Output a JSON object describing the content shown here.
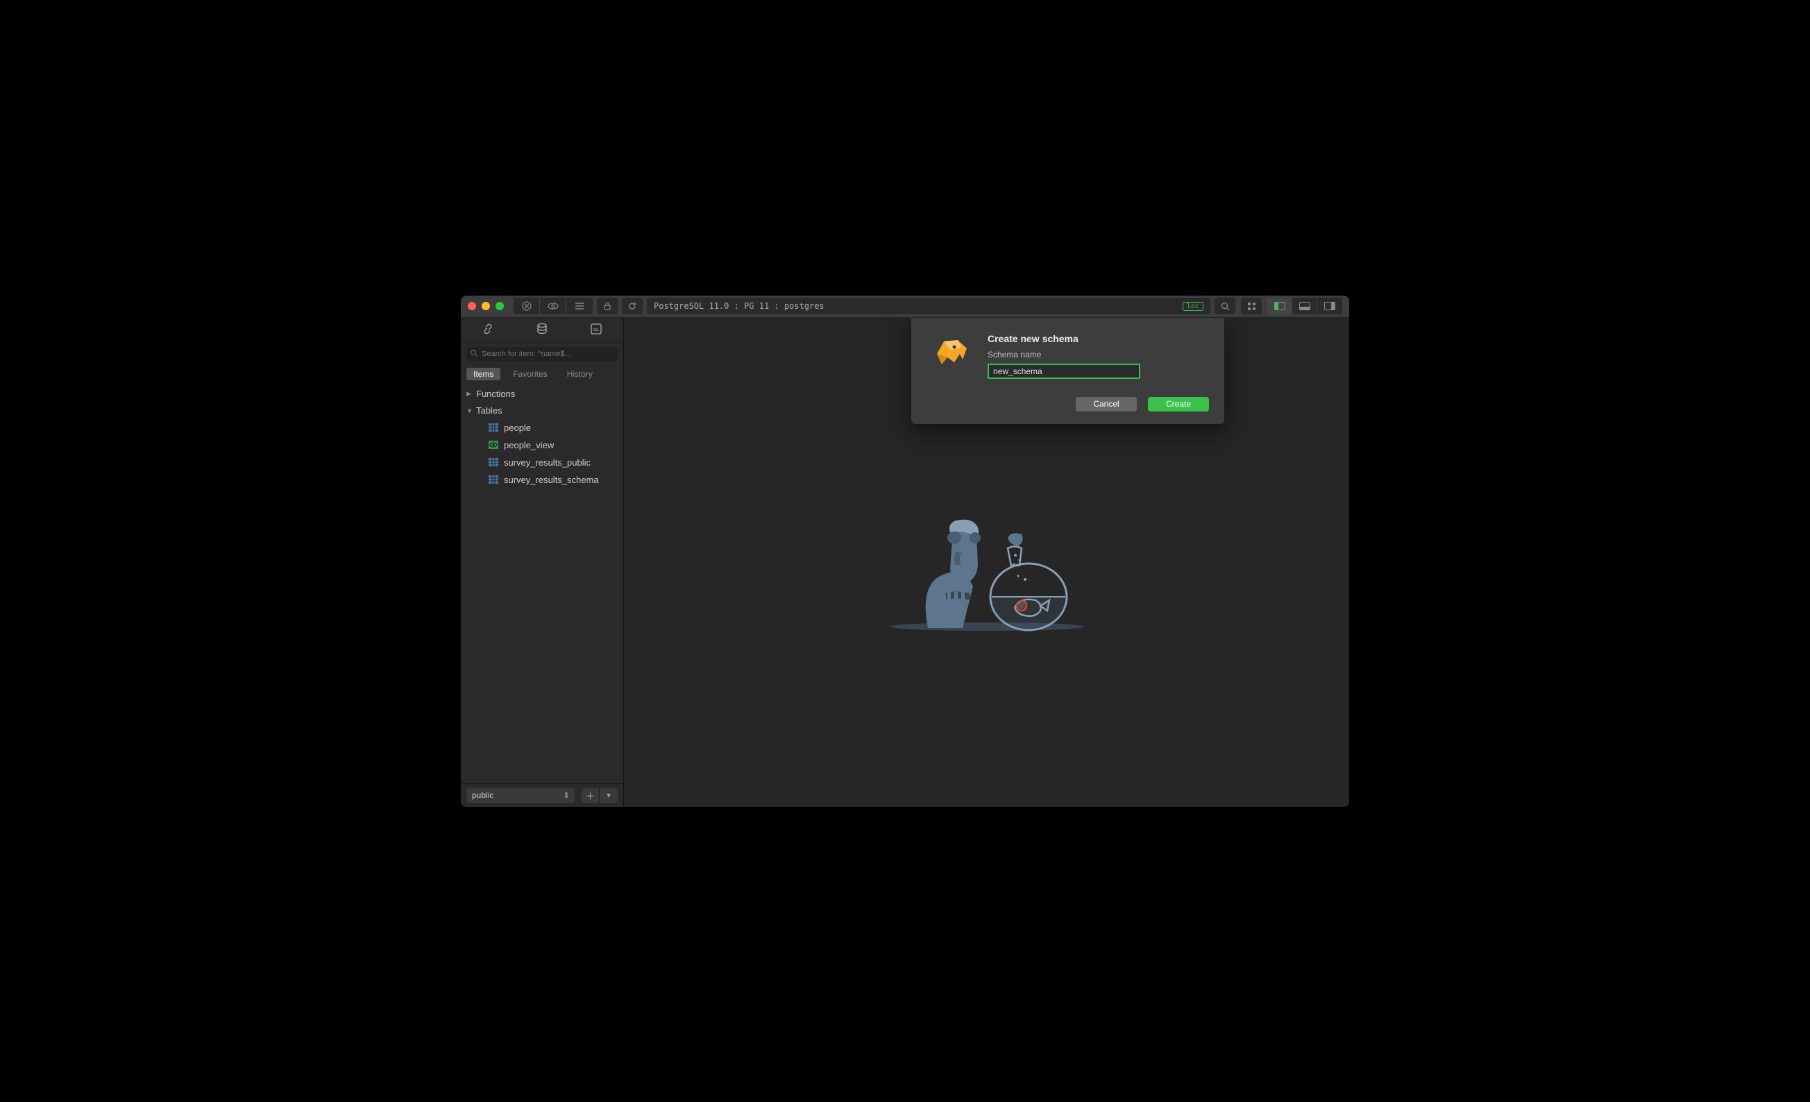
{
  "titlebar": {
    "breadcrumb": "PostgreSQL 11.0 : PG 11 : postgres",
    "loc_badge": "loc"
  },
  "sidebar": {
    "search_placeholder": "Search for item: ^name$...",
    "tabs": [
      "Items",
      "Favorites",
      "History"
    ],
    "tree": {
      "functions": "Functions",
      "tables": "Tables",
      "items": [
        {
          "name": "people",
          "type": "table"
        },
        {
          "name": "people_view",
          "type": "view"
        },
        {
          "name": "survey_results_public",
          "type": "table"
        },
        {
          "name": "survey_results_schema",
          "type": "table"
        }
      ]
    },
    "schema_selected": "public"
  },
  "dialog": {
    "title": "Create new schema",
    "label": "Schema name",
    "value": "new_schema",
    "cancel": "Cancel",
    "create": "Create"
  },
  "colors": {
    "accent": "#3ac24a"
  }
}
